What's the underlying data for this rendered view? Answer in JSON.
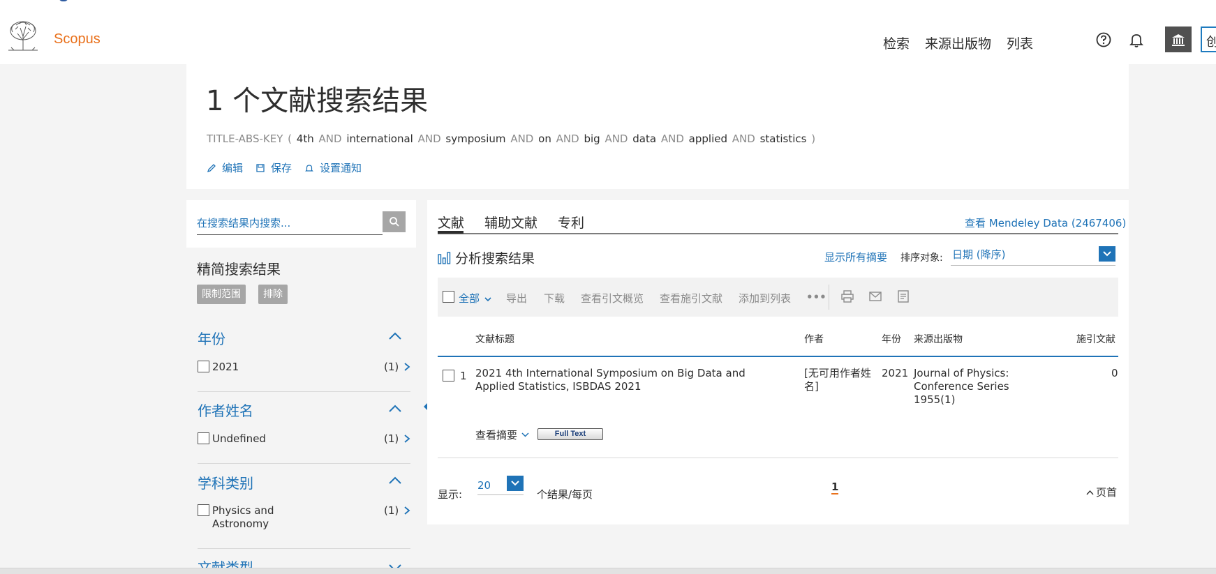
{
  "header": {
    "brand": "Scopus",
    "nav": [
      "检索",
      "来源出版物",
      "列表"
    ],
    "corner_char": "创"
  },
  "summary": {
    "title": "1 个文献搜索结果",
    "query": {
      "field": "TITLE-ABS-KEY (",
      "terms": [
        "4th",
        "AND",
        "international",
        "AND",
        "symposium",
        "AND",
        "on",
        "AND",
        "big",
        "AND",
        "data",
        "AND",
        "applied",
        "AND",
        "statistics"
      ],
      "close": ")"
    },
    "actions": {
      "edit": "编辑",
      "save": "保存",
      "alert": "设置通知"
    }
  },
  "sidebar": {
    "search_placeholder": "在搜索结果内搜索...",
    "refine_title": "精简搜索结果",
    "limit_to": "限制范围",
    "exclude": "排除",
    "facets": [
      {
        "title": "年份",
        "label": "2021",
        "count": "(1)"
      },
      {
        "title": "作者姓名",
        "label": "Undefined",
        "count": "(1)"
      },
      {
        "title": "学科类别",
        "label": "Physics and Astronomy",
        "count": "(1)"
      },
      {
        "title": "文献类型"
      }
    ]
  },
  "results": {
    "tabs": [
      "文献",
      "辅助文献",
      "专利"
    ],
    "mendeley": "查看 Mendeley Data (2467406)",
    "analyze": "分析搜索结果",
    "show_all_abstracts": "显示所有摘要",
    "sort_label": "排序对象:",
    "sort_value": "日期 (降序)",
    "toolbar": {
      "select_all": "全部",
      "export": "导出",
      "download": "下载",
      "citation_overview": "查看引文概览",
      "cited_by": "查看施引文献",
      "add_to_list": "添加到列表",
      "more": "•••"
    },
    "columns": {
      "title": "文献标题",
      "authors": "作者",
      "year": "年份",
      "source": "来源出版物",
      "cited_by": "施引文献"
    },
    "rows": [
      {
        "index": "1",
        "title": "2021 4th International Symposium on Big Data and Applied Statistics, ISBDAS 2021",
        "authors": "[无可用作者姓名]",
        "year": "2021",
        "source": "Journal of Physics: Conference Series",
        "volume": "1955(1)",
        "cited_by": "0",
        "view_abstract": "查看摘要",
        "full_text": "Full Text"
      }
    ],
    "footer": {
      "show_label": "显示:",
      "per_page_value": "20",
      "per_page_label": "个结果/每页",
      "current_page": "1",
      "top_label": "页首"
    }
  },
  "colors": {
    "brand_orange": "#e9711c",
    "link_blue": "#1f73b7"
  }
}
